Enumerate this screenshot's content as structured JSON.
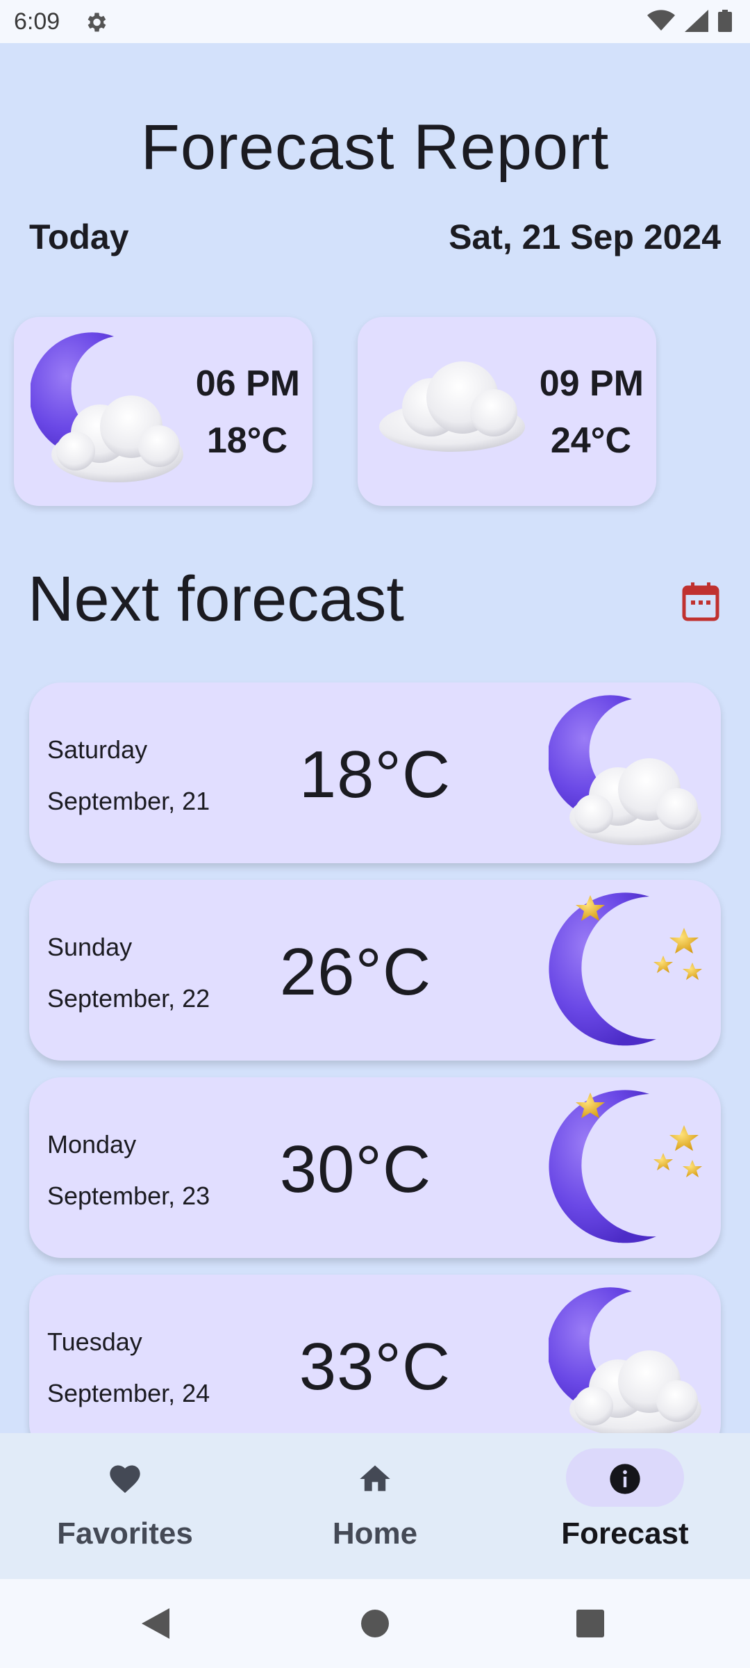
{
  "status_bar": {
    "time": "6:09"
  },
  "header": {
    "title": "Forecast Report",
    "today_label": "Today",
    "date": "Sat, 21 Sep 2024"
  },
  "hourly": [
    {
      "time": "06 PM",
      "temp": "18°C",
      "icon": "moon-cloud-icon"
    },
    {
      "time": "09 PM",
      "temp": "24°C",
      "icon": "cloud-icon"
    }
  ],
  "next_forecast": {
    "title": "Next forecast",
    "days": [
      {
        "day": "Saturday",
        "date": "September, 21",
        "temp": "18°C",
        "icon": "moon-cloud-icon"
      },
      {
        "day": "Sunday",
        "date": "September, 22",
        "temp": "26°C",
        "icon": "moon-stars-icon"
      },
      {
        "day": "Monday",
        "date": "September, 23",
        "temp": "30°C",
        "icon": "moon-stars-icon"
      },
      {
        "day": "Tuesday",
        "date": "September, 24",
        "temp": "33°C",
        "icon": "moon-cloud-icon"
      }
    ]
  },
  "bottom_nav": {
    "items": [
      {
        "label": "Favorites",
        "icon": "heart-icon"
      },
      {
        "label": "Home",
        "icon": "home-icon"
      },
      {
        "label": "Forecast",
        "icon": "info-icon",
        "selected": true
      }
    ]
  },
  "colors": {
    "background": "#d3e1fb",
    "card": "#e1deff",
    "moon": "#6a48e6",
    "star": "#e6b024",
    "calendar": "#c0312f"
  }
}
